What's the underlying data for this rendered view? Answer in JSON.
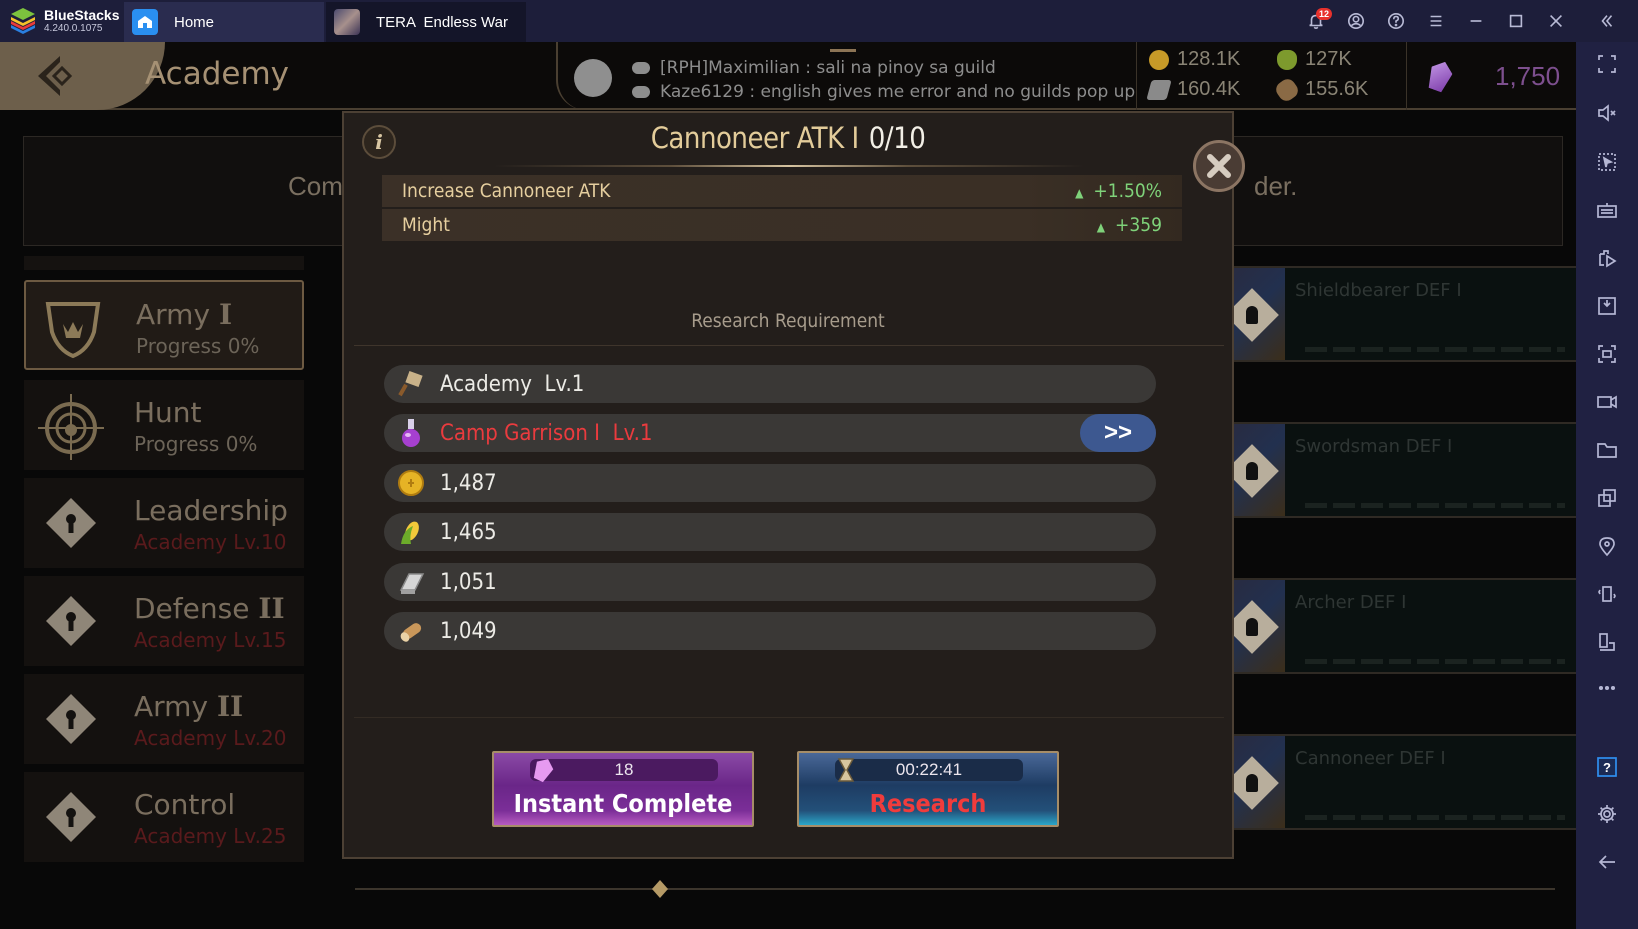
{
  "app": {
    "name": "BlueStacks",
    "version": "4.240.0.1075",
    "notification_count": "12"
  },
  "tabs": [
    {
      "label": "Home",
      "icon": "home-icon"
    },
    {
      "label": "TERA  Endless War",
      "icon": "game-icon"
    }
  ],
  "titlebar_controls": [
    "bell-icon",
    "account-icon",
    "help-icon",
    "menu-icon",
    "minimize-icon",
    "maximize-icon",
    "close-icon",
    "collapse-sidebar-icon"
  ],
  "sidebar_tools": [
    "fullscreen-icon",
    "mute-icon",
    "pointer-select-icon",
    "keyboard-icon",
    "media-manager-icon",
    "install-apk-icon",
    "screenshot-icon",
    "record-icon",
    "folder-icon",
    "multi-instance-icon",
    "location-icon",
    "shake-icon",
    "rotate-icon",
    "more-icon",
    "help-box-icon",
    "settings-icon",
    "back-icon"
  ],
  "game": {
    "page_title": "Academy",
    "chat": [
      "[RPH]Maximilian : sali na pinoy sa guild",
      "Kaze6129 : english gives me error and no guilds pop up"
    ],
    "resources": {
      "gold": "128.1K",
      "food": "127K",
      "iron": "160.4K",
      "wood": "155.6K",
      "gems": "1,750"
    },
    "banner_left": "Com",
    "banner_right": "der.",
    "categories": [
      {
        "name": "Army",
        "numeral": "I",
        "sub": "Progress 0%",
        "locked": false,
        "active": true
      },
      {
        "name": "Hunt",
        "numeral": "",
        "sub": "Progress 0%",
        "locked": false,
        "active": false
      },
      {
        "name": "Leadership",
        "numeral": "",
        "sub": "Academy Lv.10",
        "locked": true,
        "active": false
      },
      {
        "name": "Defense",
        "numeral": "II",
        "sub": "Academy Lv.15",
        "locked": true,
        "active": false
      },
      {
        "name": "Army",
        "numeral": "II",
        "sub": "Academy Lv.20",
        "locked": true,
        "active": false
      },
      {
        "name": "Control",
        "numeral": "",
        "sub": "Academy Lv.25",
        "locked": true,
        "active": false
      }
    ],
    "tech_cards": [
      "Shieldbearer DEF I",
      "Swordsman DEF I",
      "Archer DEF I",
      "Cannoneer DEF I"
    ]
  },
  "modal": {
    "title": "Cannoneer ATK I",
    "level": "0/10",
    "stats": [
      {
        "label": "Increase Cannoneer ATK",
        "value": "+1.50%"
      },
      {
        "label": "Might",
        "value": "+359"
      }
    ],
    "requirement_title": "Research Requirement",
    "requirements": [
      {
        "icon": "hammer-icon",
        "text": "Academy  Lv.1",
        "met": true
      },
      {
        "icon": "potion-icon",
        "text": "Camp Garrison I  Lv.1",
        "met": false,
        "goto_label": ">>"
      },
      {
        "icon": "gold-coin-icon",
        "text": "1,487",
        "met": true
      },
      {
        "icon": "corn-icon",
        "text": "1,465",
        "met": true
      },
      {
        "icon": "iron-ingot-icon",
        "text": "1,051",
        "met": true
      },
      {
        "icon": "wood-log-icon",
        "text": "1,049",
        "met": true
      }
    ],
    "instant": {
      "cost": "18",
      "label": "Instant Complete"
    },
    "research": {
      "time": "00:22:41",
      "label": "Research"
    }
  },
  "colors": {
    "bluestacks_bar": "#1d1e3a",
    "modal_bg": "#231e1b",
    "stat_green": "#7fd27a",
    "unmet_red": "#ea3b3e",
    "title_gold": "#e3cc9a",
    "instant_purple": "#6a2688",
    "research_blue": "#1e3c63"
  }
}
